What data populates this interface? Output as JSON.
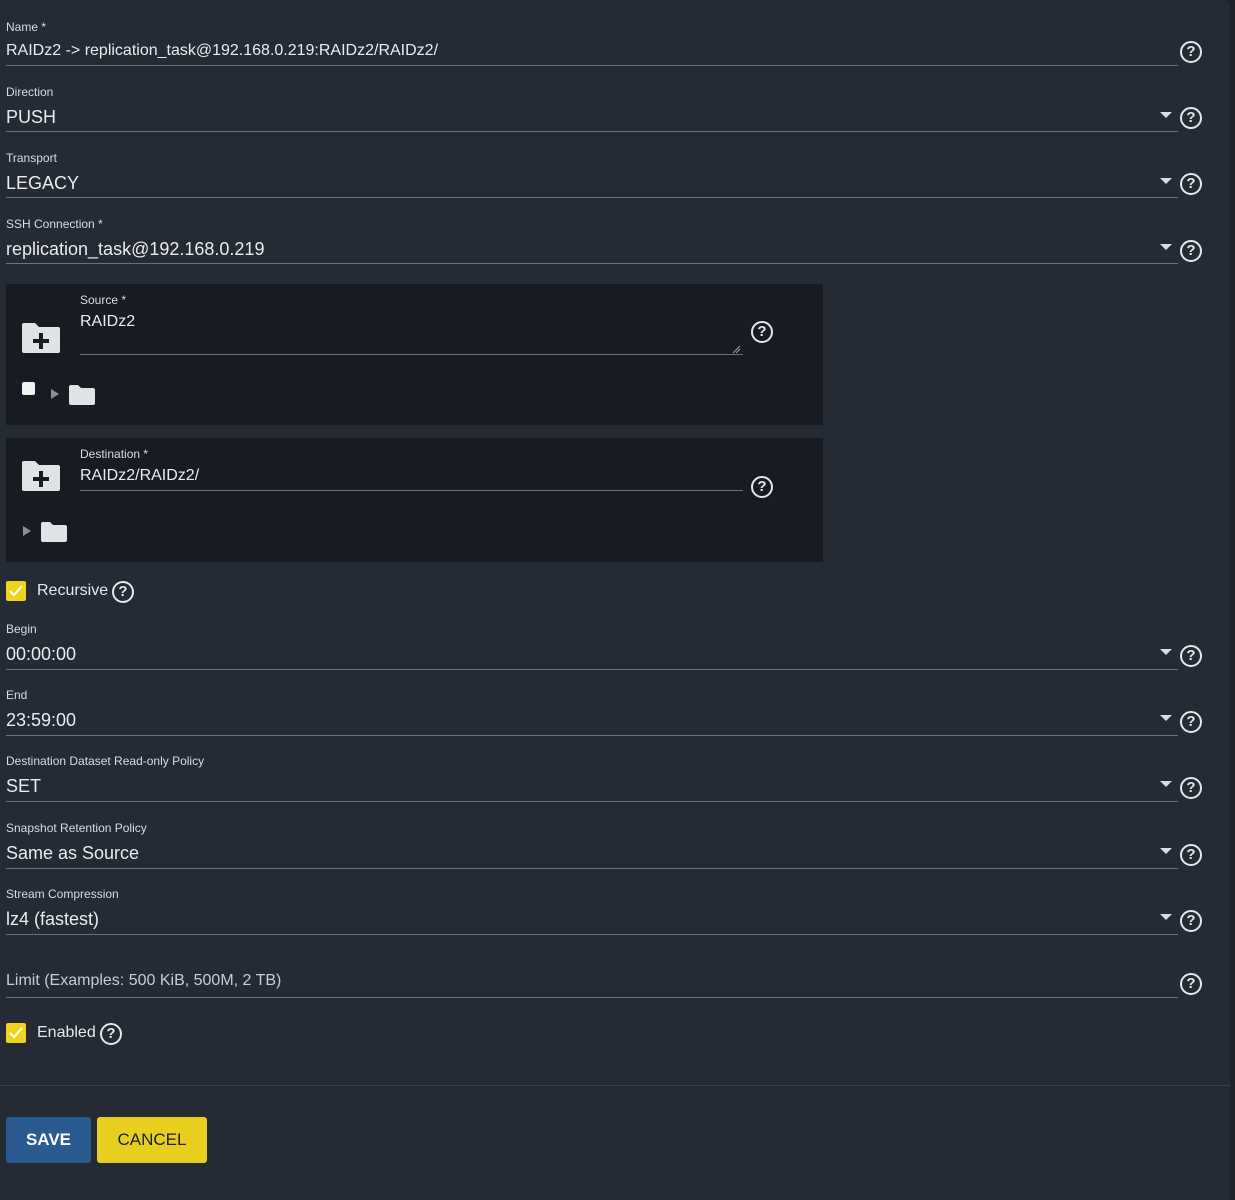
{
  "form": {
    "name": {
      "label": "Name *",
      "value": "RAIDz2 -> replication_task@192.168.0.219:RAIDz2/RAIDz2/"
    },
    "direction": {
      "label": "Direction",
      "value": "PUSH"
    },
    "transport": {
      "label": "Transport",
      "value": "LEGACY"
    },
    "ssh_connection": {
      "label": "SSH Connection *",
      "value": "replication_task@192.168.0.219"
    },
    "source": {
      "label": "Source *",
      "value": "RAIDz2"
    },
    "destination": {
      "label": "Destination *",
      "value": "RAIDz2/RAIDz2/"
    },
    "recursive": {
      "label": "Recursive",
      "checked": true
    },
    "begin": {
      "label": "Begin",
      "value": "00:00:00"
    },
    "end": {
      "label": "End",
      "value": "23:59:00"
    },
    "readonly_policy": {
      "label": "Destination Dataset Read-only Policy",
      "value": "SET"
    },
    "retention_policy": {
      "label": "Snapshot Retention Policy",
      "value": "Same as Source"
    },
    "stream_compression": {
      "label": "Stream Compression",
      "value": "lz4 (fastest)"
    },
    "limit": {
      "placeholder": "Limit (Examples: 500 KiB, 500M, 2 TB)"
    },
    "enabled": {
      "label": "Enabled",
      "checked": true
    }
  },
  "actions": {
    "save_label": "SAVE",
    "cancel_label": "CANCEL"
  },
  "help_glyph": "?",
  "icons": {
    "help": "help-circle-icon",
    "dropdown": "caret-down-icon",
    "folder_add": "folder-plus-icon",
    "folder": "folder-icon",
    "expand": "triangle-right-icon",
    "check": "checkmark-icon"
  },
  "colors": {
    "background": "#252b35",
    "panel": "#181c22",
    "accent_yellow": "#e8cf1f",
    "save_blue": "#2a5a8f"
  }
}
